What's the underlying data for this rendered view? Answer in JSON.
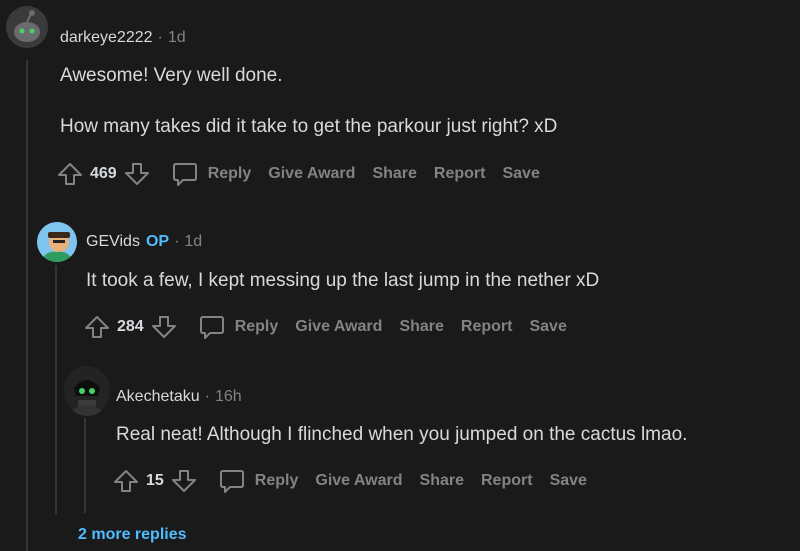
{
  "comments": [
    {
      "author": "darkeye2222",
      "op": "",
      "age": "1d",
      "lines": [
        "Awesome! Very well done.",
        "How many takes did it take to get the parkour just right? xD"
      ],
      "score": "469"
    },
    {
      "author": "GEVids",
      "op": "OP",
      "age": "1d",
      "lines": [
        "It took a few, I kept messing up the last jump in the nether xD"
      ],
      "score": "284"
    },
    {
      "author": "Akechetaku",
      "op": "",
      "age": "16h",
      "lines": [
        "Real neat! Although I flinched when you jumped on the cactus lmao."
      ],
      "score": "15"
    }
  ],
  "actions": {
    "reply": "Reply",
    "give_award": "Give Award",
    "share": "Share",
    "report": "Report",
    "save": "Save"
  },
  "sep": "·",
  "more_replies": "2 more replies",
  "colors": {
    "background": "#1a1a1b",
    "text": "#d7dadc",
    "muted": "#818384",
    "accent": "#4fbcff",
    "thread_line": "#343536"
  }
}
